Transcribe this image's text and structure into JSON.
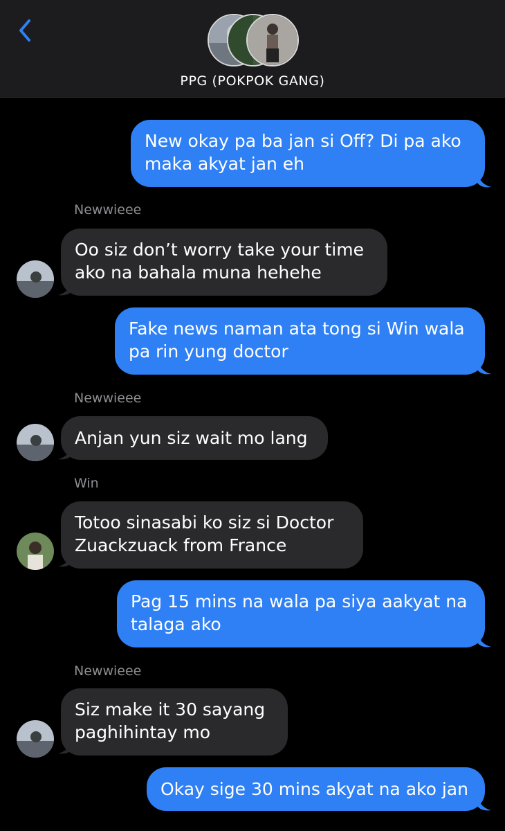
{
  "header": {
    "back_icon": "chevron-left-icon",
    "group_name": "PPG (POKPOK GANG)"
  },
  "messages": [
    {
      "direction": "outgoing",
      "text": "New okay pa ba jan si Off? Di pa ako maka akyat jan eh"
    },
    {
      "direction": "incoming",
      "sender": "Newwieee",
      "text": "Oo siz don’t worry take your time ako na bahala muna hehehe"
    },
    {
      "direction": "outgoing",
      "text": "Fake news naman ata tong si Win wala pa rin yung doctor"
    },
    {
      "direction": "incoming",
      "sender": "Newwieee",
      "text": "Anjan yun siz wait mo lang"
    },
    {
      "direction": "incoming",
      "sender": "Win",
      "text": "Totoo sinasabi ko siz si Doctor Zuackzuack from France"
    },
    {
      "direction": "outgoing",
      "text": "Pag 15 mins na wala pa siya aakyat na talaga ako"
    },
    {
      "direction": "incoming",
      "sender": "Newwieee",
      "text": "Siz make it 30 sayang paghihintay mo"
    },
    {
      "direction": "outgoing",
      "text": "Okay sige 30 mins akyat na ako jan"
    }
  ],
  "colors": {
    "outgoing": "#2f80f5",
    "incoming": "#2a2a2c",
    "accent": "#2f80f5",
    "sender": "#8e8e93"
  }
}
